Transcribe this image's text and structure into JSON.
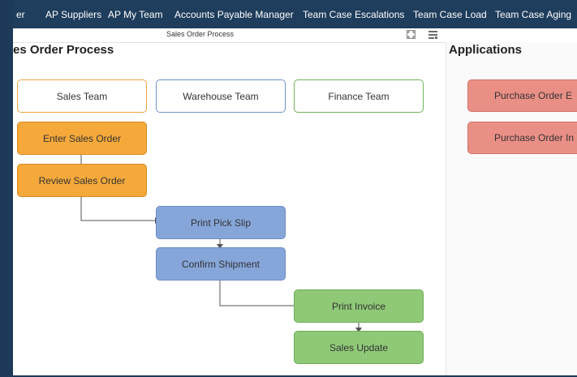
{
  "nav": {
    "items": [
      "er",
      "AP Suppliers",
      "AP My Team",
      "Accounts Payable Manager",
      "Team Case Escalations",
      "Team Case Load",
      "Team Case Aging"
    ]
  },
  "subbar": {
    "title": "Sales Order Process"
  },
  "left": {
    "heading": "es Order Process",
    "teams": [
      "Sales Team",
      "Warehouse Team",
      "Finance Team"
    ],
    "steps": {
      "enter_sales_order": "Enter Sales Order",
      "review_sales_order": "Review Sales Order",
      "print_pick_slip": "Print Pick Slip",
      "confirm_shipment": "Confirm Shipment",
      "print_invoice": "Print Invoice",
      "sales_update": "Sales Update"
    }
  },
  "right": {
    "heading": "Applications",
    "apps": [
      "Purchase Order E",
      "Purchase Order In"
    ]
  },
  "colors": {
    "nav_bg": "#1f3d5c",
    "sales_team_border": "#f0a542",
    "warehouse_team_border": "#6e95cf",
    "finance_team_border": "#6fb457",
    "orange_step": "#f5a93b",
    "blue_step": "#86a6da",
    "green_step": "#8fc977",
    "app_button": "#ea8f86"
  },
  "icons": [
    "expand-icon",
    "settings-icon"
  ]
}
